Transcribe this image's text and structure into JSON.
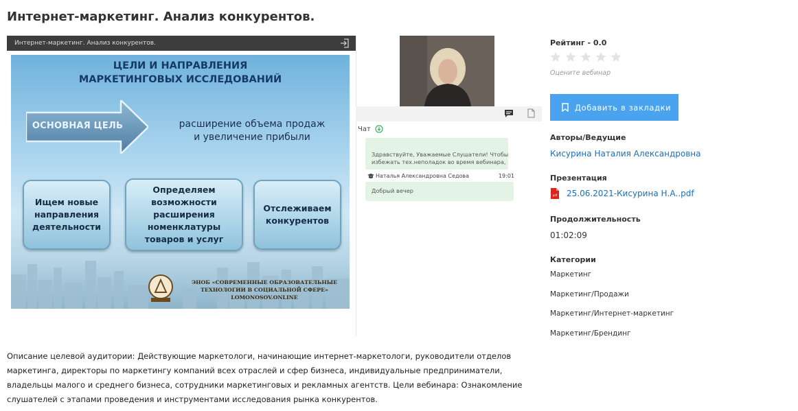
{
  "page": {
    "title": "Интернет-маркетинг. Анализ конкурентов."
  },
  "player": {
    "bar_title": "Интернет-маркетинг. Анализ конкурентов.",
    "slide": {
      "heading_line1": "ЦЕЛИ И НАПРАВЛЕНИЯ",
      "heading_line2": "МАРКЕТИНГОВЫХ ИССЛЕДОВАНИЙ",
      "arrow_label": "ОСНОВНАЯ ЦЕЛЬ",
      "goal_line1": "расширение объема продаж",
      "goal_line2": "и увеличение прибыли",
      "card1": [
        "Ищем новые",
        "направления",
        "деятельности"
      ],
      "card2": [
        "Определяем",
        "возможности",
        "расширения",
        "номенклатуры",
        "товаров и  услуг"
      ],
      "card3": [
        "Отслеживаем",
        "конкурентов"
      ],
      "logo_line1": "ЭНОБ «СОВРЕМЕННЫЕ ОБРАЗОВАТЕЛЬНЫЕ",
      "logo_line2": "ТЕХНОЛОГИИ В СОЦИАЛЬНОЙ СФЕРЕ»",
      "logo_line3": "LOMONOSOV.ONLINE"
    }
  },
  "chat": {
    "label": "Чат",
    "messages": [
      {
        "text_line1": "Здравствуйте, Уважаемые Слушатели! Чтобы",
        "text_line2": "избежать тех.неполадок во время вебинара,"
      },
      {
        "author": "Наталья Александровна Седова",
        "time": "19:01",
        "text": "Добрый вечер"
      }
    ]
  },
  "sidebar": {
    "rating_label": "Рейтинг - 0.0",
    "rating_value": 0,
    "rating_max": 5,
    "rate_hint": "Оцените вебинар",
    "bookmark_label": "Добавить в закладки",
    "authors_label": "Авторы/Ведущие",
    "author_name": "Кисурина Наталия Александровна",
    "presentation_label": "Презентация",
    "presentation_file": "25.06.2021-Кисурина Н.А..pdf",
    "pdf_badge": "pdf",
    "duration_label": "Продолжительность",
    "duration_value": "01:02:09",
    "categories_label": "Категории",
    "categories": [
      "Маркетинг",
      "Маркетинг/Продажи",
      "Маркетинг/Интернет-маркетинг",
      "Маркетинг/Брендинг"
    ]
  },
  "description": "Описание целевой аудитории: Действующие маркетологи, начинающие интернет-маркетологи, руководители отделов маркетинга, директоры по маркетингу компаний всех отраслей и сфер бизнеса, индивидуальные предприниматели, владельцы малого и среднего бизнеса, сотрудники маркетинговых и рекламных агентств. Цели вебинара: Ознакомление слушателей с этапами проведения и инструментами исследования рынка конкурентов.",
  "colors": {
    "accent": "#4aa3ee",
    "link": "#1a6fb8",
    "chat_bubble": "#e3f4e6",
    "player_bar": "#3d3d3d"
  },
  "icons": [
    "exit-icon",
    "chat-icon",
    "document-icon",
    "chat-down-icon",
    "graduation-cap-icon",
    "star-icon",
    "bookmark-icon",
    "pdf-icon"
  ]
}
